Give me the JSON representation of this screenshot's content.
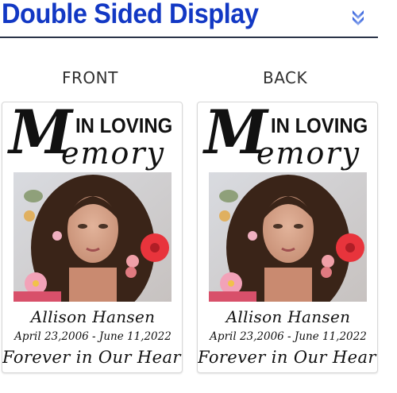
{
  "header": {
    "title": "Double Sided Display",
    "chevron_icon": "double-chevron-down-icon",
    "title_color": "#1238c4"
  },
  "sides": {
    "front_label": "FRONT",
    "back_label": "BACK"
  },
  "card": {
    "heading_top": "IN LOVING",
    "heading_m": "M",
    "heading_rest": "emory",
    "photo": "portrait-photo",
    "name": "Allison Hansen",
    "dates": "April 23,2006 - June 11,2022",
    "tribute": "Forever in Our Heart"
  }
}
